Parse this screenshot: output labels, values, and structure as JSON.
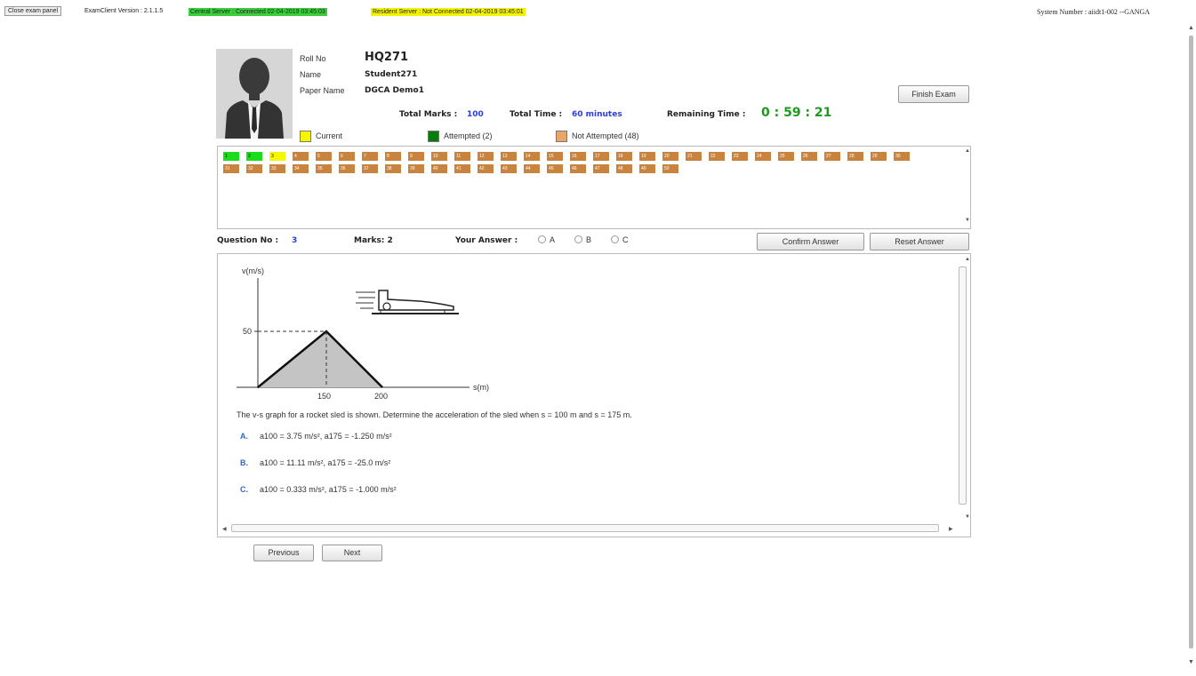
{
  "topbar": {
    "close_label": "Close exam panel",
    "version": "ExamClient Version : 2.1.1.5",
    "central_status": "Central Server : Connected 02-04-2019 03:45:03",
    "resident_status": "Resident Server : Not Connected 02-04-2019 03:45:01",
    "system_number": "System Number : aiidt1-002 --GANGA"
  },
  "candidate": {
    "roll_label": "Roll No",
    "roll_value": "HQ271",
    "name_label": "Name",
    "name_value": "Student271",
    "paper_label": "Paper Name",
    "paper_value": "DGCA Demo1"
  },
  "stats": {
    "total_marks_label": "Total Marks :",
    "total_marks_value": "100",
    "total_time_label": "Total Time :",
    "total_time_value": "60 minutes",
    "remaining_label": "Remaining Time :",
    "remaining_value": "0 : 59 : 21"
  },
  "finish_label": "Finish Exam",
  "legend": {
    "current": "Current",
    "attempted": "Attempted (2)",
    "not_attempted": "Not Attempted (48)"
  },
  "colors": {
    "attempted": "#1ddc1d",
    "current": "#f6f600",
    "not_attempted": "#c8843f",
    "timer": "#1a9c1a"
  },
  "palette": {
    "attempted": [
      1,
      2
    ],
    "current": 3,
    "questions": [
      1,
      2,
      3,
      4,
      5,
      6,
      7,
      8,
      9,
      10,
      11,
      12,
      13,
      14,
      15,
      16,
      17,
      18,
      19,
      20,
      21,
      22,
      23,
      24,
      25,
      26,
      27,
      28,
      29,
      30,
      31,
      32,
      33,
      34,
      35,
      36,
      37,
      38,
      39,
      40,
      41,
      42,
      43,
      44,
      45,
      46,
      47,
      48,
      49,
      50
    ]
  },
  "question_bar": {
    "qno_label": "Question No :",
    "qno_value": "3",
    "marks_label": "Marks: 2",
    "answer_label": "Your Answer :",
    "options": [
      "A",
      "B",
      "C"
    ],
    "confirm_label": "Confirm Answer",
    "reset_label": "Reset Answer"
  },
  "figure": {
    "y_axis_label": "v(m/s)",
    "x_axis_label": "s(m)",
    "y_tick": "50",
    "x_ticks": [
      "150",
      "200"
    ]
  },
  "question": {
    "text": "The v-s graph for a rocket sled is shown. Determine the acceleration of the sled when s = 100 m and s = 175 m.",
    "options": [
      {
        "letter": "A.",
        "text": "a100 = 3.75 m/s², a175 = -1.250 m/s²"
      },
      {
        "letter": "B.",
        "text": "a100 = 11.11 m/s², a175 = -25.0 m/s²"
      },
      {
        "letter": "C.",
        "text": "a100 = 0.333 m/s², a175 = -1.000 m/s²"
      }
    ]
  },
  "nav": {
    "previous": "Previous",
    "next": "Next"
  }
}
